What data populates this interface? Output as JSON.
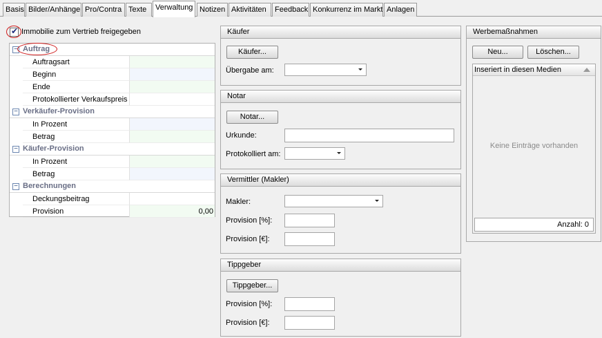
{
  "tabs": [
    {
      "label": "Basis"
    },
    {
      "label": "Bilder/Anhänge"
    },
    {
      "label": "Pro/Contra"
    },
    {
      "label": "Texte"
    },
    {
      "label": "Verwaltung"
    },
    {
      "label": "Notizen"
    },
    {
      "label": "Aktivitäten"
    },
    {
      "label": "Feedback"
    },
    {
      "label": "Konkurrenz im Markt"
    },
    {
      "label": "Anlagen"
    }
  ],
  "active_tab": "Verwaltung",
  "freigabe": {
    "label": "Immobilie zum Vertrieb freigegeben",
    "checked": true
  },
  "grid": {
    "auftrag": {
      "label": "Auftrag",
      "toggle": "−",
      "items": [
        {
          "label": "Auftragsart",
          "value": ""
        },
        {
          "label": "Beginn",
          "value": ""
        },
        {
          "label": "Ende",
          "value": ""
        },
        {
          "label": "Protokollierter Verkaufspreis",
          "value": ""
        }
      ]
    },
    "vk_provision": {
      "label": "Verkäufer-Provision",
      "toggle": "−",
      "items": [
        {
          "label": "In Prozent",
          "value": ""
        },
        {
          "label": "Betrag",
          "value": ""
        }
      ]
    },
    "k_provision": {
      "label": "Käufer-Provision",
      "toggle": "−",
      "items": [
        {
          "label": "In Prozent",
          "value": ""
        },
        {
          "label": "Betrag",
          "value": ""
        }
      ]
    },
    "berechnungen": {
      "label": "Berechnungen",
      "toggle": "−",
      "items": [
        {
          "label": "Deckungsbeitrag",
          "value": ""
        },
        {
          "label": "Provision",
          "value": "0,00"
        }
      ]
    }
  },
  "kaeufer": {
    "title": "Käufer",
    "button": "Käufer...",
    "uebergabe_label": "Übergabe am:",
    "uebergabe_value": ""
  },
  "notar": {
    "title": "Notar",
    "button": "Notar...",
    "urkunde_label": "Urkunde:",
    "urkunde_value": "",
    "protokolliert_label": "Protokolliert am:",
    "protokolliert_value": ""
  },
  "vermittler": {
    "title": "Vermittler (Makler)",
    "makler_label": "Makler:",
    "makler_value": "",
    "prov_pct_label": "Provision [%]:",
    "prov_pct_value": "",
    "prov_eur_label": "Provision [€]:",
    "prov_eur_value": ""
  },
  "tippgeber": {
    "title": "Tippgeber",
    "button": "Tippgeber...",
    "prov_pct_label": "Provision [%]:",
    "prov_pct_value": "",
    "prov_eur_label": "Provision [€]:",
    "prov_eur_value": ""
  },
  "werbung": {
    "title": "Werbemaßnahmen",
    "new_button": "Neu...",
    "delete_button": "Löschen...",
    "column_header": "Inseriert in diesen Medien",
    "empty_text": "Keine Einträge vorhanden",
    "count": "Anzahl: 0"
  },
  "colors": {
    "highlight_oval": "#d02020",
    "category_text": "#6a6f86",
    "toggle_border": "#6b86b0"
  },
  "icons": {
    "checkbox": "check-icon",
    "category_toggle": "collapse-icon",
    "combo": "chevron-down-icon",
    "sort": "sort-up-icon"
  }
}
